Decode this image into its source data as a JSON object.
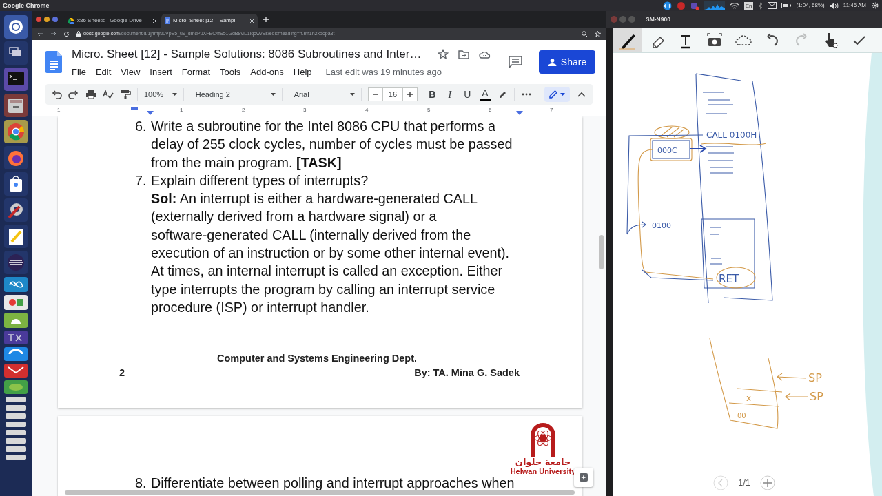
{
  "system_bar": {
    "app_name": "Google Chrome",
    "keyboard_layout": "En",
    "battery": "(1:04, 68%)",
    "clock": "11:46 AM"
  },
  "browser": {
    "tabs": [
      {
        "label": "x86 Sheets - Google Drive",
        "selected": false
      },
      {
        "label": "Micro. Sheet [12] - Sampl",
        "selected": true
      }
    ],
    "url_host": "docs.google.com",
    "url_path": "/document/d/1j4mjN0VpS5_u9_dmcPuXFEC4fS51GdB8vIL1iqowvSs/edit#heading=h.rm1n2xdopa3t"
  },
  "docs": {
    "title": "Micro. Sheet [12] - Sample Solutions: 8086 Subroutines and Inter…",
    "menu": [
      "File",
      "Edit",
      "View",
      "Insert",
      "Format",
      "Tools",
      "Add-ons",
      "Help"
    ],
    "last_edit": "Last edit was 19 minutes ago",
    "share": "Share",
    "toolbar": {
      "zoom": "100%",
      "style": "Heading 2",
      "font": "Arial",
      "font_size": "16",
      "bold": "B",
      "italic": "I",
      "underline": "U",
      "text_color": "A"
    },
    "ruler": [
      "1",
      "1",
      "2",
      "3",
      "4",
      "5",
      "6",
      "7"
    ],
    "items": [
      {
        "number": "6.",
        "text": "Write a subroutine for the Intel 8086 CPU that performs a delay of 255 clock cycles, number of cycles must be passed from the main program. **[TASK]**"
      },
      {
        "number": "7.",
        "text": "Explain different types of interrupts?",
        "answer": "**Sol:** An interrupt is either a hardware-generated CALL (externally derived from a hardware signal) or a software-generated CALL (internally derived from the execution of an instruction or by some other internal event). At times, an internal interrupt is called an exception. Either type interrupts the program by calling an interrupt service procedure (ISP) or interrupt handler."
      }
    ],
    "footer": {
      "department": "Computer and Systems Engineering Dept.",
      "page": "2",
      "author": "By: TA. Mina G. Sadek"
    },
    "logo": {
      "arabic": "جامعة حلوان",
      "english": "Helwan University"
    },
    "next_item": {
      "number": "8.",
      "text": "Differentiate between polling and interrupt approaches when"
    }
  },
  "notes_app": {
    "title": "SM-N900",
    "page": "1/1",
    "tools": [
      {
        "kind": "pen",
        "selected": true,
        "disabled": false
      },
      {
        "kind": "eraser",
        "selected": false,
        "disabled": false
      },
      {
        "kind": "text",
        "selected": false,
        "disabled": false
      },
      {
        "kind": "camera",
        "selected": false,
        "disabled": false
      },
      {
        "kind": "lasso",
        "selected": false,
        "disabled": false
      },
      {
        "kind": "undo",
        "selected": false,
        "disabled": false
      },
      {
        "kind": "redo",
        "selected": false,
        "disabled": true
      },
      {
        "kind": "hand",
        "selected": false,
        "disabled": false
      },
      {
        "kind": "done",
        "selected": false,
        "disabled": false
      }
    ],
    "notes": [
      {
        "text": "CALL 0100H",
        "color": "#3b5ba8"
      },
      {
        "text": "000C",
        "color": "#3b5ba8"
      },
      {
        "text": "0100",
        "color": "#3b5ba8"
      },
      {
        "text": "RET",
        "color": "#3b5ba8"
      },
      {
        "text": "SP",
        "color": "#d39a4a"
      },
      {
        "text": "SP",
        "color": "#d39a4a"
      },
      {
        "text": "x",
        "color": "#d39a4a"
      },
      {
        "text": "00",
        "color": "#d39a4a"
      }
    ]
  }
}
